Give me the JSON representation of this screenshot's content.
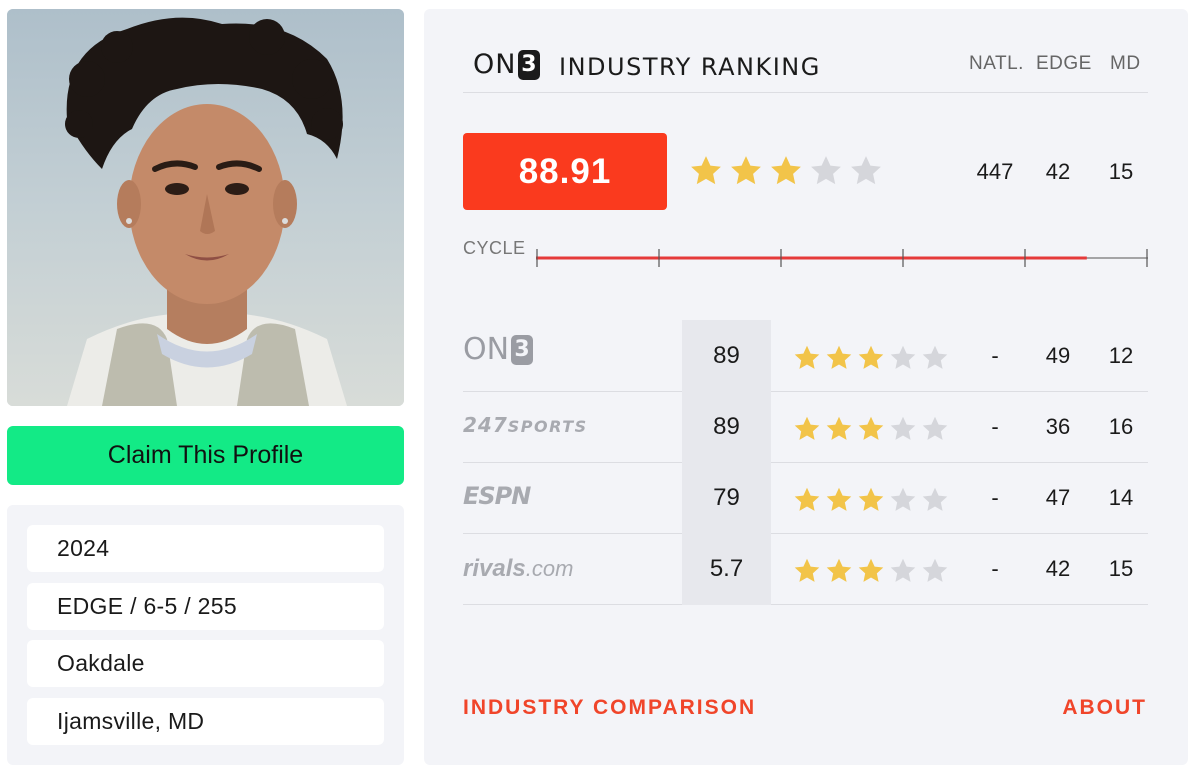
{
  "profile": {
    "claim_label": "Claim This Profile",
    "info": [
      "2024",
      "EDGE / 6-5 / 255",
      "Oakdale",
      "Ijamsville, MD"
    ]
  },
  "ranking": {
    "brand_prefix": "ON",
    "brand_digit": "3",
    "title": "INDUSTRY RANKING",
    "columns": [
      "NATL.",
      "EDGE",
      "MD"
    ],
    "score": "88.91",
    "stars": 3,
    "max_stars": 5,
    "natl": "447",
    "edge": "42",
    "state": "15",
    "cycle_label": "CYCLE",
    "cycle_progress": 0.9
  },
  "services": [
    {
      "name": "On3",
      "logo_icon": "on3-logo-icon",
      "rating": "89",
      "stars": 3,
      "natl": "-",
      "edge": "49",
      "state": "12"
    },
    {
      "name": "247SPORTS",
      "logo_icon": "247sports-logo-icon",
      "rating": "89",
      "stars": 3,
      "natl": "-",
      "edge": "36",
      "state": "16"
    },
    {
      "name": "ESPN",
      "logo_icon": "espn-logo-icon",
      "rating": "79",
      "stars": 3,
      "natl": "-",
      "edge": "47",
      "state": "14"
    },
    {
      "name": "rivals.com",
      "logo_icon": "rivals-logo-icon",
      "rating": "5.7",
      "stars": 3,
      "natl": "-",
      "edge": "42",
      "state": "15"
    }
  ],
  "footer": {
    "comparison_label": "INDUSTRY COMPARISON",
    "about_label": "ABOUT"
  },
  "colors": {
    "accent_red": "#fa3a1e",
    "claim_green": "#13ea86",
    "star_gold": "#f2c449",
    "star_empty": "#d5d6db",
    "link_red": "#f0452a"
  }
}
